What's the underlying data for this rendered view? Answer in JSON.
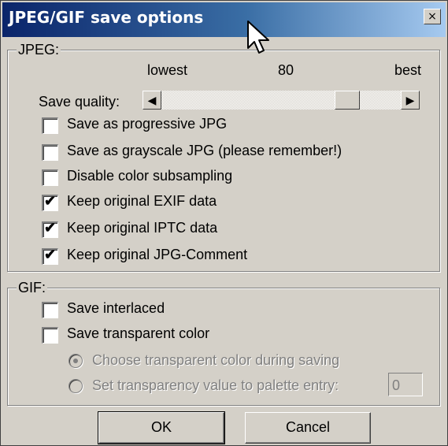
{
  "window": {
    "title": "JPEG/GIF save options",
    "close_label": "×"
  },
  "jpeg": {
    "legend": "JPEG:",
    "scale_lowest": "lowest",
    "scale_value": "80",
    "scale_best": "best",
    "quality_label": "Save quality:",
    "quality_value": 80,
    "scroll_left": "◀",
    "scroll_right": "▶",
    "options": [
      {
        "label": "Save as progressive JPG",
        "checked": false
      },
      {
        "label": "Save as grayscale JPG (please remember!)",
        "checked": false
      },
      {
        "label": "Disable color subsampling",
        "checked": false
      },
      {
        "label": "Keep original EXIF data",
        "checked": true
      },
      {
        "label": "Keep original IPTC data",
        "checked": true
      },
      {
        "label": "Keep original JPG-Comment",
        "checked": true
      }
    ]
  },
  "gif": {
    "legend": "GIF:",
    "interlaced_label": "Save interlaced",
    "transparent_label": "Save transparent color",
    "radio_choose_label": "Choose transparent color during saving",
    "radio_set_label": "Set transparency value to palette entry:",
    "palette_entry_value": "0"
  },
  "buttons": {
    "ok": "OK",
    "cancel": "Cancel"
  },
  "check_glyph": "✔"
}
